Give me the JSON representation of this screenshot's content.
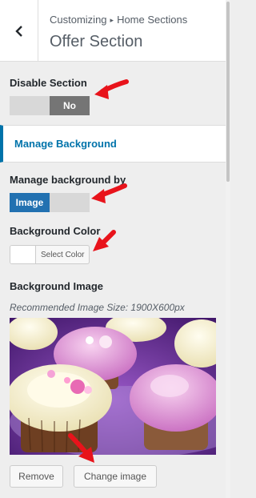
{
  "header": {
    "breadcrumb_root": "Customizing",
    "breadcrumb_separator": "▸",
    "breadcrumb_current": "Home Sections",
    "title": "Offer Section"
  },
  "disable_section": {
    "label": "Disable Section",
    "value": "No"
  },
  "manage_background_link": "Manage Background",
  "manage_background_by": {
    "label": "Manage background by",
    "value": "Image"
  },
  "background_color": {
    "label": "Background Color",
    "button_label": "Select Color",
    "current_color": "#ffffff"
  },
  "background_image": {
    "label": "Background Image",
    "hint": "Recommended Image Size: 1900X600px",
    "remove_label": "Remove",
    "change_label": "Change image"
  },
  "colors": {
    "accent": "#0073aa",
    "toggle_active_blue": "#2271b1",
    "toggle_active_dark": "#757575",
    "annotation_arrow": "#e8131b"
  },
  "icons": [
    "back-chevron-icon"
  ]
}
